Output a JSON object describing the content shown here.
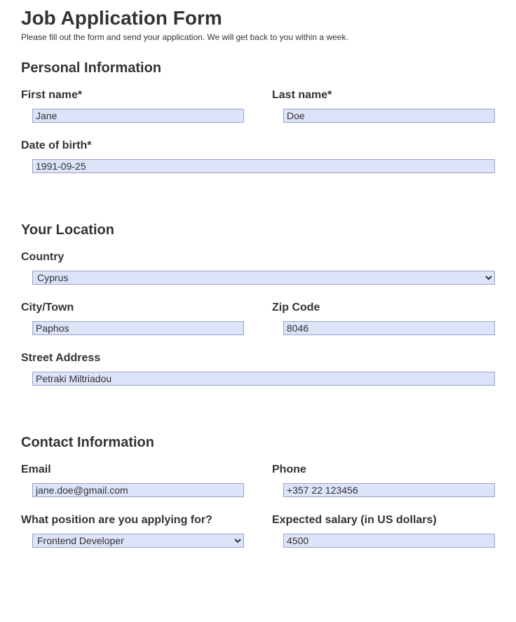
{
  "header": {
    "title": "Job Application Form",
    "subtitle": "Please fill out the form and send your application. We will get back to you within a week."
  },
  "sections": {
    "personal": {
      "heading": "Personal Information",
      "first_name_label": "First name*",
      "first_name_value": "Jane",
      "last_name_label": "Last name*",
      "last_name_value": "Doe",
      "dob_label": "Date of birth*",
      "dob_value": "1991-09-25"
    },
    "location": {
      "heading": "Your Location",
      "country_label": "Country",
      "country_value": "Cyprus",
      "city_label": "City/Town",
      "city_value": "Paphos",
      "zip_label": "Zip Code",
      "zip_value": "8046",
      "street_label": "Street Address",
      "street_value": "Petraki Miltriadou"
    },
    "contact": {
      "heading": "Contact Information",
      "email_label": "Email",
      "email_value": "jane.doe@gmail.com",
      "phone_label": "Phone",
      "phone_value": "+357 22 123456"
    },
    "position": {
      "position_label": "What position are you applying for?",
      "position_value": "Frontend Developer",
      "salary_label": "Expected salary (in US dollars)",
      "salary_value": "4500"
    }
  }
}
